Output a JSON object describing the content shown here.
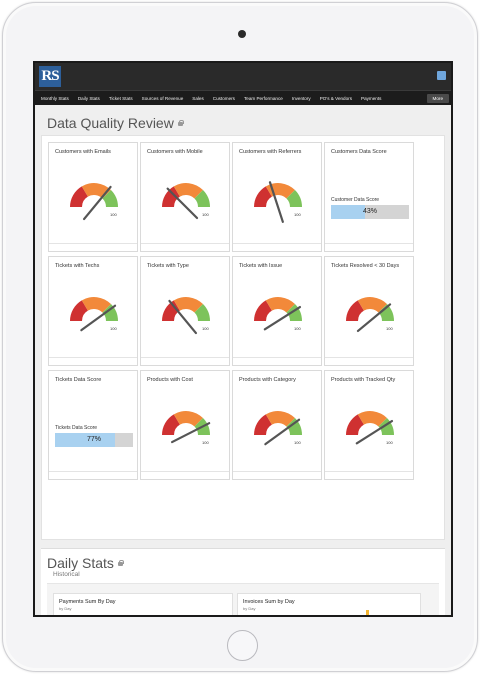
{
  "app": {
    "logo_text": "RS",
    "nav_items": [
      "Monthly Stats",
      "Daily Stats",
      "Ticket Stats",
      "Sources of Revenue",
      "Sales",
      "Customers",
      "Team Performance",
      "Inventory",
      "PO's & Vendors",
      "Payments"
    ],
    "nav_more": "More"
  },
  "data_quality": {
    "title": "Data Quality Review",
    "cards": [
      {
        "title": "Customers with Emails",
        "kind": "gauge",
        "max": "100",
        "level": 0.72
      },
      {
        "title": "Customers with Mobile",
        "kind": "gauge",
        "max": "100",
        "level": 0.25
      },
      {
        "title": "Customers with Referrers",
        "kind": "gauge",
        "max": "100",
        "level": 0.4
      },
      {
        "title": "Customers Data Score",
        "kind": "score",
        "label": "Customer Data Score",
        "value": "43%",
        "fraction": 0.43
      },
      {
        "title": "Tickets with Techs",
        "kind": "gauge",
        "max": "100",
        "level": 0.8
      },
      {
        "title": "Tickets with Type",
        "kind": "gauge",
        "max": "100",
        "level": 0.28
      },
      {
        "title": "Tickets with Issue",
        "kind": "gauge",
        "max": "100",
        "level": 0.82
      },
      {
        "title": "Tickets Resolved < 30 Days",
        "kind": "gauge",
        "max": "100",
        "level": 0.78
      },
      {
        "title": "Tickets Data Score",
        "kind": "score",
        "label": "Tickets Data Score",
        "value": "77%",
        "fraction": 0.77
      },
      {
        "title": "Products with Cost",
        "kind": "gauge",
        "max": "100",
        "level": 0.85
      },
      {
        "title": "Products with Category",
        "kind": "gauge",
        "max": "100",
        "level": 0.8
      },
      {
        "title": "Products with Tracked Qty",
        "kind": "gauge",
        "max": "100",
        "level": 0.82
      }
    ]
  },
  "daily_stats": {
    "title": "Daily Stats",
    "historical_label": "Historical",
    "charts": [
      {
        "title": "Payments Sum By Day",
        "subtitle": "by Day",
        "axis_tick": "0k"
      },
      {
        "title": "Invoices Sum by Day",
        "subtitle": "by Day",
        "axis_tick": "0k"
      }
    ]
  },
  "colors": {
    "gauge_red": "#cf3131",
    "gauge_orange": "#f2893a",
    "gauge_green": "#7dc35b",
    "needle": "#555555",
    "score_fill": "#a8d1f0",
    "score_bg": "#d4d4d4",
    "accent_bar": "#f5b530"
  }
}
